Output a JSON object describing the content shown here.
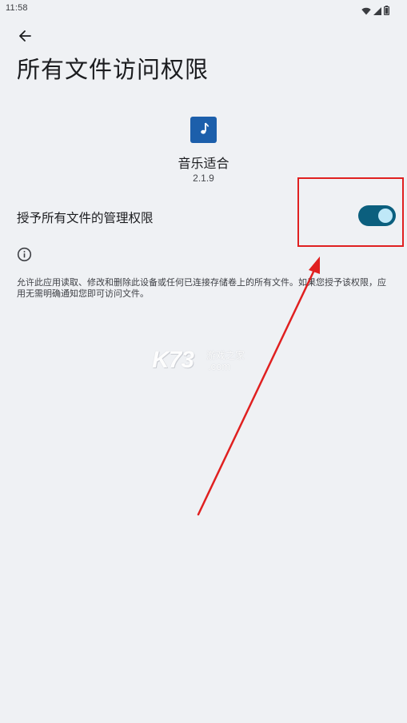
{
  "status_bar": {
    "time": "11:58",
    "icons": [
      "wifi-icon",
      "signal-icon",
      "battery-icon"
    ]
  },
  "header": {
    "back_icon": "back-arrow-icon",
    "title": "所有文件访问权限"
  },
  "app": {
    "icon": "music-note-icon",
    "name": "音乐适合",
    "version": "2.1.9"
  },
  "permission": {
    "label": "授予所有文件的管理权限",
    "enabled": true
  },
  "info": {
    "icon": "info-icon",
    "description": "允许此应用读取、修改和删除此设备或任何已连接存储卷上的所有文件。如果您授予该权限，应用无需明确通知您即可访问文件。"
  },
  "watermark": {
    "logo": "K73",
    "text": "游戏之家",
    "domain": ".com"
  },
  "colors": {
    "background": "#eff1f4",
    "app_icon": "#1c5fab",
    "toggle_track": "#0b5f7e",
    "toggle_thumb": "#bfe8f8",
    "annotation": "#e02020"
  }
}
